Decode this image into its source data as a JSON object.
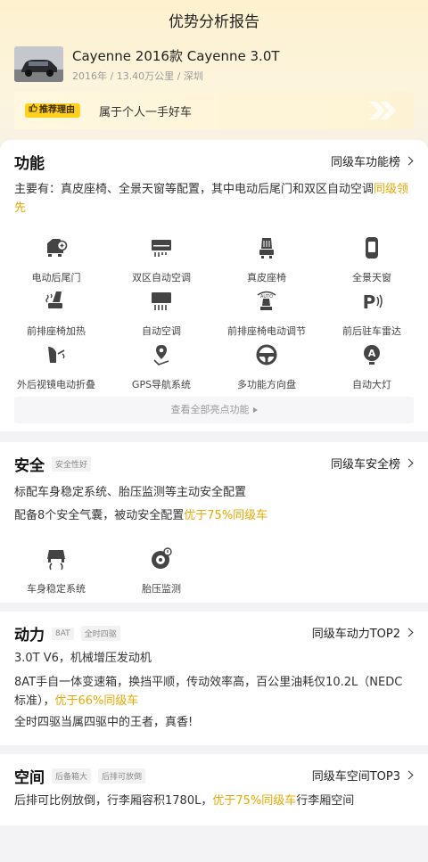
{
  "header": {
    "title": "优势分析报告"
  },
  "car": {
    "name": "Cayenne 2016款 Cayenne 3.0T",
    "meta": "2016年 / 13.40万公里 / 深圳"
  },
  "reason": {
    "tag": "推荐理由",
    "text": "属于个人一手好车"
  },
  "function": {
    "title": "功能",
    "rank": "同级车功能榜",
    "desc_prefix": "主要有：真皮座椅、全景天窗等配置，其中电动后尾门和双区自动空调",
    "desc_highlight": "同级领先",
    "features": [
      {
        "label": "电动后尾门",
        "icon": "tailgate-icon"
      },
      {
        "label": "双区自动空调",
        "icon": "dual-ac-icon"
      },
      {
        "label": "真皮座椅",
        "icon": "leather-seat-icon"
      },
      {
        "label": "全景天窗",
        "icon": "sunroof-icon"
      },
      {
        "label": "前排座椅加热",
        "icon": "seat-heating-icon"
      },
      {
        "label": "自动空调",
        "icon": "auto-ac-icon"
      },
      {
        "label": "前排座椅电动调节",
        "icon": "power-seat-icon"
      },
      {
        "label": "前后驻车雷达",
        "icon": "parking-radar-icon"
      },
      {
        "label": "外后视镜电动折叠",
        "icon": "mirror-fold-icon"
      },
      {
        "label": "GPS导航系统",
        "icon": "gps-icon"
      },
      {
        "label": "多功能方向盘",
        "icon": "steering-wheel-icon"
      },
      {
        "label": "自动大灯",
        "icon": "auto-headlight-icon"
      }
    ],
    "view_all": "查看全部亮点功能"
  },
  "safety": {
    "title": "安全",
    "tag": "安全性好",
    "rank": "同级车安全榜",
    "line1": "标配车身稳定系统、胎压监测等主动安全配置",
    "line2_prefix": "配备8个安全气囊，被动安全配置",
    "line2_highlight": "优于75%同级车",
    "features": [
      {
        "label": "车身稳定系统",
        "icon": "stability-control-icon"
      },
      {
        "label": "胎压监测",
        "icon": "tire-pressure-icon"
      }
    ]
  },
  "power": {
    "title": "动力",
    "tags": [
      "8AT",
      "全时四驱"
    ],
    "rank": "同级车动力TOP2",
    "line1": "3.0T V6，机械增压发动机",
    "line2a": "8AT手自一体变速箱，换挡平顺，传动效率高，百公里油耗仅10.2L（NEDC",
    "line2b": "标准），",
    "line2_highlight": "优于66%同级车",
    "line3": "全时四驱当属四驱中的王者，真香!"
  },
  "space": {
    "title": "空间",
    "tags": [
      "后备箱大",
      "后排可放倒"
    ],
    "rank": "同级车空间TOP3",
    "line_prefix": "后排可比例放倒，行李厢容积1780L，",
    "line_highlight": "优于75%同级车",
    "line_suffix": "行李厢空间"
  },
  "colors": {
    "accent": "#ffd11a",
    "highlight": "#e8a800"
  }
}
